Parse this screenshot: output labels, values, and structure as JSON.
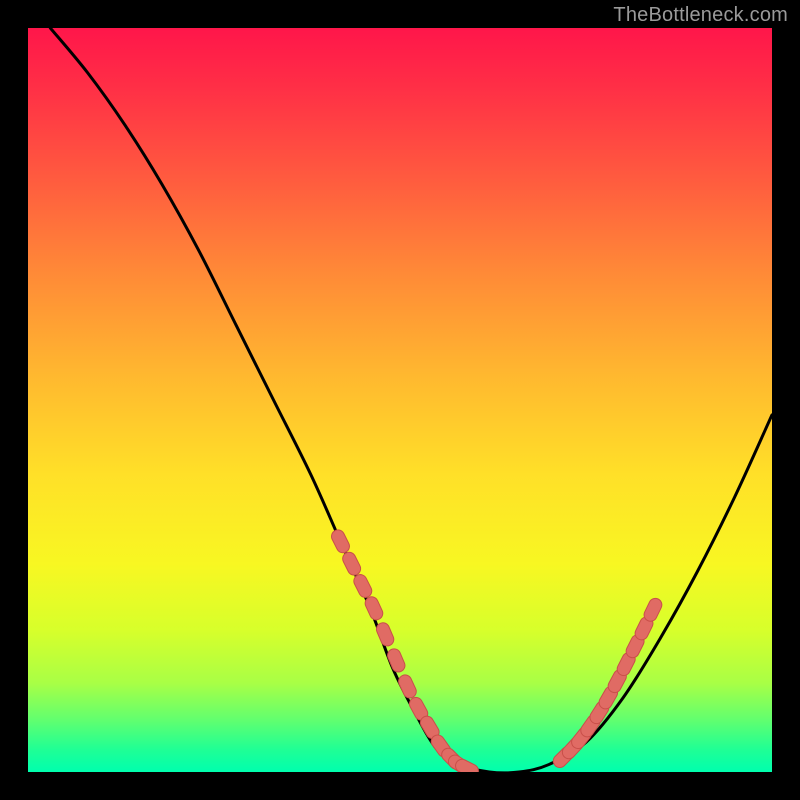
{
  "attribution": "TheBottleneck.com",
  "colors": {
    "background": "#000000",
    "gradient_top": "#ff164a",
    "gradient_bottom": "#00ffae",
    "curve_stroke": "#000000",
    "marker_fill": "#e06b64",
    "marker_stroke": "#c94f49",
    "attribution_text": "#9a9a9a"
  },
  "chart_data": {
    "type": "line",
    "title": "",
    "xlabel": "",
    "ylabel": "",
    "xlim": [
      0,
      100
    ],
    "ylim": [
      0,
      100
    ],
    "grid": false,
    "legend": false,
    "series": [
      {
        "name": "bottleneck-curve",
        "x": [
          3,
          8,
          13,
          18,
          23,
          28,
          33,
          38,
          42,
          46,
          49,
          52,
          55,
          58,
          62,
          66,
          70,
          75,
          80,
          85,
          90,
          95,
          100
        ],
        "y": [
          100,
          94,
          87,
          79,
          70,
          60,
          50,
          40,
          31,
          22,
          14,
          8,
          3,
          1,
          0,
          0,
          1,
          4,
          10,
          18,
          27,
          37,
          48
        ]
      }
    ],
    "markers": {
      "left_cluster_x": [
        42,
        43.5,
        45,
        46.5,
        48,
        49.5,
        51,
        52.5,
        54,
        55.5,
        57,
        58,
        59
      ],
      "left_cluster_y": [
        31,
        28,
        25,
        22,
        18.5,
        15,
        11.5,
        8.5,
        6,
        3.5,
        1.8,
        1,
        0.5
      ],
      "right_cluster_x": [
        72,
        73.2,
        74.4,
        75.6,
        76.8,
        78,
        79.2,
        80.4,
        81.6,
        82.8,
        84
      ],
      "right_cluster_y": [
        2,
        3.2,
        4.6,
        6.2,
        8,
        10,
        12.2,
        14.5,
        16.9,
        19.3,
        21.8
      ]
    }
  }
}
